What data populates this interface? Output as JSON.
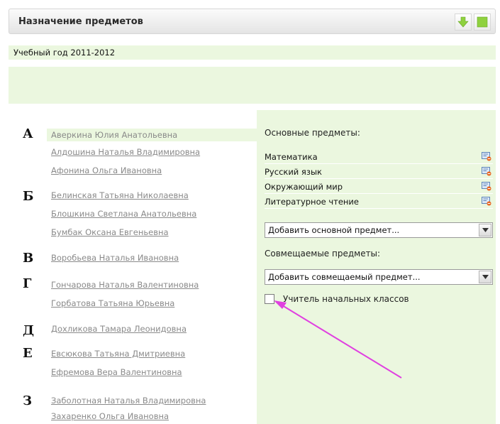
{
  "header": {
    "title": "Назначение предметов",
    "buttons": [
      {
        "icon": "green-down-arrow-icon"
      },
      {
        "icon": "green-square-icon"
      }
    ],
    "accent_color": "#8fd13f"
  },
  "year": "Учебный год 2011-2012",
  "teacher_groups": [
    {
      "letter": "А",
      "names": [
        "Аверкина Юлия Анатольевна",
        "Алдошина Наталья Владимировна",
        "Афонина Ольга Ивановна"
      ]
    },
    {
      "letter": "Б",
      "names": [
        "Белинская Татьяна Николаевна",
        "Блошкина Светлана Анатольевна",
        "Бумбак Оксана Евгеньевна"
      ]
    },
    {
      "letter": "В",
      "names": [
        "Воробьева Наталья Ивановна"
      ]
    },
    {
      "letter": "Г",
      "names": [
        "Гончарова Наталья Валентиновна",
        "Горбатова Татьяна Юрьевна"
      ]
    },
    {
      "letter": "Д",
      "names": [
        "Дохликова Тамара Леонидовна"
      ]
    },
    {
      "letter": "Е",
      "names": [
        "Евсюкова Татьяна Дмитриевна",
        "Ефремова Вера Валентиновна"
      ]
    },
    {
      "letter": "З",
      "names": [
        "Заболотная Наталья Владимировна",
        "Захаренко Ольга Ивановна"
      ]
    }
  ],
  "selected_teacher": "Аверкина Юлия Анатольевна",
  "panel": {
    "main_label": "Основные предметы:",
    "main_subjects": [
      "Математика",
      "Русский язык",
      "Окружающий мир",
      "Литературное чтение"
    ],
    "add_main_select": "Добавить основной предмет...",
    "combined_label": "Совмещаемые предметы:",
    "add_combined_select": "Добавить совмещаемый предмет...",
    "primary_teacher_checkbox": {
      "label": "Учитель начальных классов",
      "checked": false
    }
  },
  "colors": {
    "panel_bg": "#ebf7df",
    "annotation_arrow": "#e040e0"
  }
}
